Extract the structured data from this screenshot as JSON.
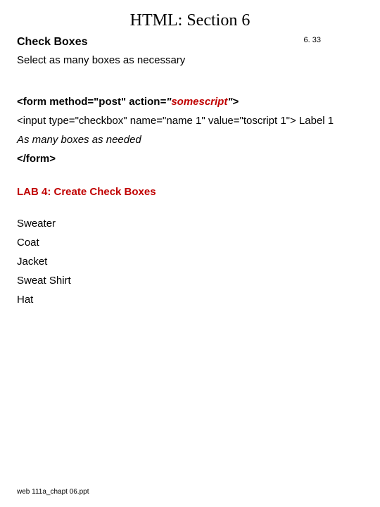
{
  "title": "HTML: Section 6",
  "subhead": "Check Boxes",
  "pagenum": "6. 33",
  "select_line": "Select as many boxes as necessary",
  "form_open": {
    "p1": "<form method=\"post\" action",
    "eq": "=",
    "q1": "\"",
    "script": "somescript",
    "q2": "\"",
    "close": ">"
  },
  "code_line": "<input type=\"checkbox\" name=\"name 1\" value=\"toscript 1\"> Label 1",
  "note_line": "As many boxes as needed",
  "form_close": "</form>",
  "lab_title": "LAB 4: Create Check Boxes",
  "items": {
    "i0": "Sweater",
    "i1": "Coat",
    "i2": "Jacket",
    "i3": "Sweat Shirt",
    "i4": "Hat"
  },
  "footer": "web 111a_chapt 06.ppt"
}
